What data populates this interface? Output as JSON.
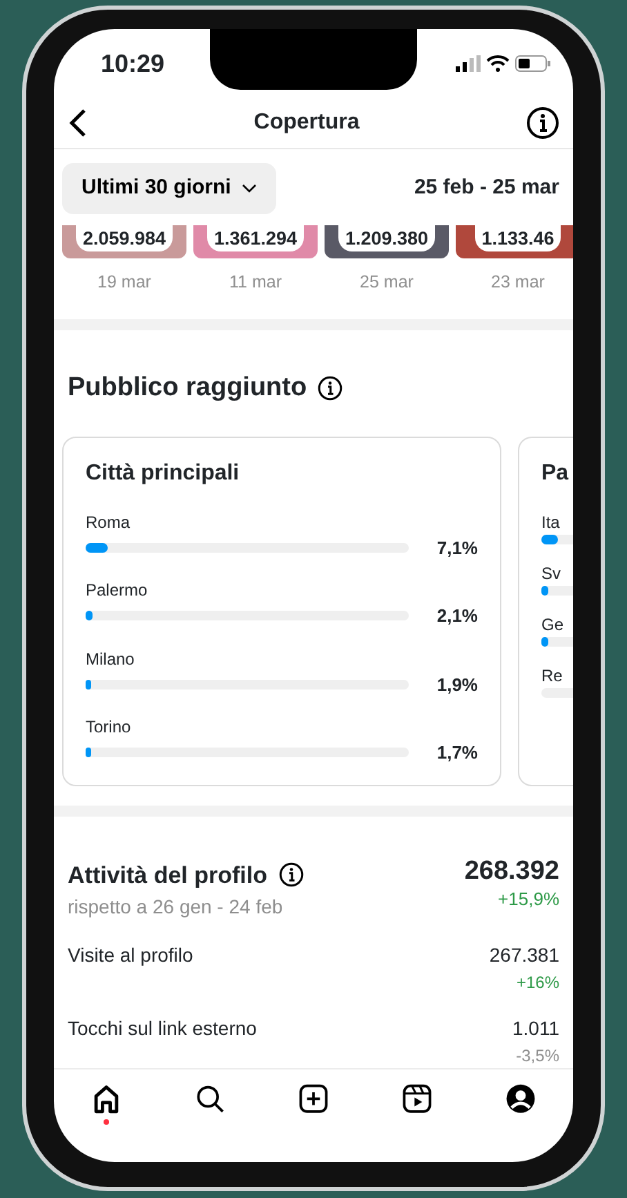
{
  "status_bar": {
    "time": "10:29"
  },
  "header": {
    "title": "Copertura"
  },
  "filter": {
    "period": "Ultimi 30 giorni",
    "range": "25 feb - 25 mar"
  },
  "top_content": [
    {
      "count": "2.059.984",
      "date": "19 mar"
    },
    {
      "count": "1.361.294",
      "date": "11 mar"
    },
    {
      "count": "1.209.380",
      "date": "25 mar"
    },
    {
      "count": "1.133.46",
      "date": "23 mar"
    }
  ],
  "audience": {
    "title": "Pubblico raggiunto",
    "cards": [
      {
        "title": "Città principali",
        "rows": [
          {
            "label": "Roma",
            "level": 0.07,
            "value": "7,1%"
          },
          {
            "label": "Palermo",
            "level": 0.021,
            "value": "2,1%"
          },
          {
            "label": "Milano",
            "level": 0.019,
            "value": "1,9%"
          },
          {
            "label": "Torino",
            "level": 0.017,
            "value": "1,7%"
          }
        ]
      },
      {
        "title": "Pa",
        "rows": [
          {
            "label": "Ita",
            "level": 0.05
          },
          {
            "label": "Sv",
            "level": 0.02
          },
          {
            "label": "Ge",
            "level": 0.02
          },
          {
            "label": "Re"
          }
        ]
      }
    ]
  },
  "profile_activity": {
    "title": "Attività del profilo",
    "subtitle": "rispetto a 26 gen - 24 feb",
    "total": "268.392",
    "total_change": "+15,9%",
    "rows": [
      {
        "label": "Visite al profilo",
        "value": "267.381",
        "change": "+16%",
        "color": "#2e9a48"
      },
      {
        "label": "Tocchi sul link esterno",
        "value": "1.011",
        "change": "-3,5%",
        "color": "#8e8e8e"
      }
    ]
  },
  "tab_bar": [
    {
      "kind": "home",
      "selected": true
    },
    {
      "kind": "search",
      "selected": false
    },
    {
      "kind": "create",
      "selected": false
    },
    {
      "kind": "reels",
      "selected": false
    },
    {
      "kind": "profile",
      "selected": false
    }
  ]
}
